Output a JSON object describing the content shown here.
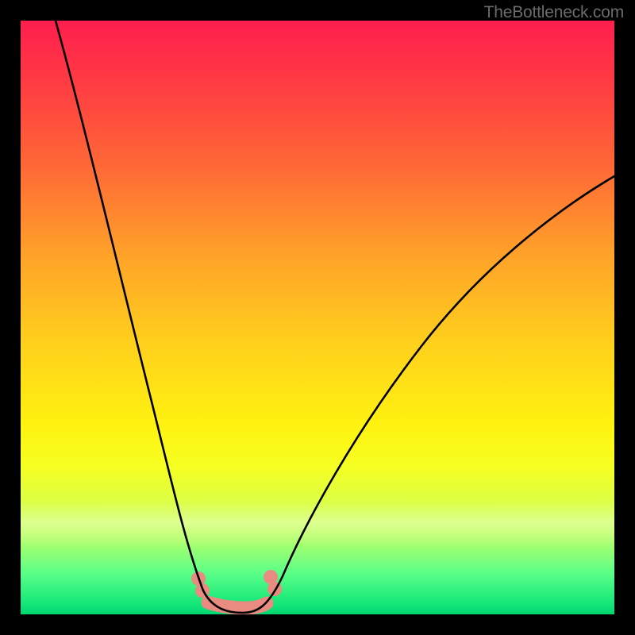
{
  "watermark": "TheBottleneck.com",
  "chart_data": {
    "type": "line",
    "title": "",
    "xlabel": "",
    "ylabel": "",
    "xlim": [
      0,
      100
    ],
    "ylim": [
      0,
      100
    ],
    "series": [
      {
        "name": "left-curve",
        "x": [
          6,
          10,
          14,
          18,
          22,
          25,
          27.5,
          30,
          32
        ],
        "values": [
          100,
          85,
          67,
          49,
          31,
          18,
          10,
          4,
          2.4
        ]
      },
      {
        "name": "bottom-segment",
        "x": [
          32,
          34,
          36,
          38,
          40,
          42
        ],
        "values": [
          2.4,
          1.3,
          1.0,
          1.0,
          1.3,
          2.7
        ]
      },
      {
        "name": "right-curve",
        "x": [
          42,
          46,
          52,
          60,
          70,
          82,
          94,
          100
        ],
        "values": [
          2.7,
          5.5,
          12,
          23,
          36,
          49,
          60,
          65
        ]
      },
      {
        "name": "salmon-overlay",
        "x": [
          30.5,
          32,
          34.5,
          38.5,
          41,
          42.5
        ],
        "values": [
          5.2,
          2.6,
          1.4,
          1.4,
          2.6,
          5.6
        ]
      }
    ],
    "colors": {
      "curve": "#000000",
      "overlay": "#e98b81",
      "gradient_top": "#ff1e4f",
      "gradient_bottom": "#00d670"
    }
  }
}
